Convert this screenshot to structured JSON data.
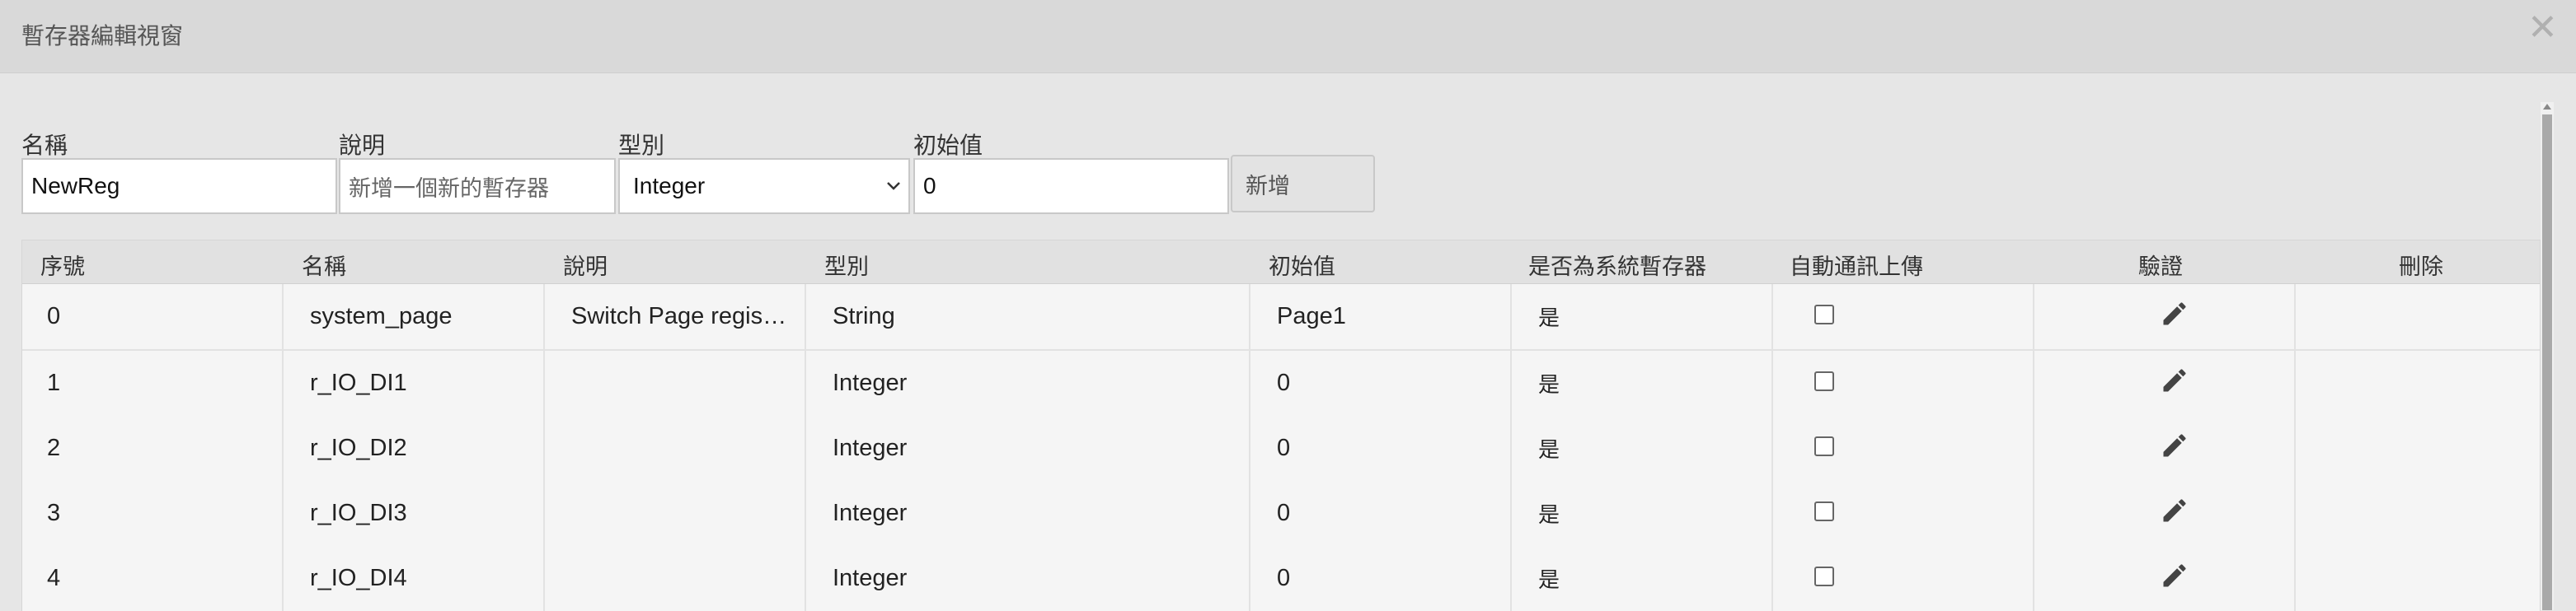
{
  "window": {
    "title": "暫存器編輯視窗",
    "close_icon": "close-icon"
  },
  "form": {
    "name_label": "名稱",
    "name_value": "NewReg",
    "desc_label": "說明",
    "desc_placeholder": "新增一個新的暫存器",
    "type_label": "型別",
    "type_value": "Integer",
    "init_label": "初始值",
    "init_value": "0",
    "add_button": "新增"
  },
  "table": {
    "columns": [
      "序號",
      "名稱",
      "說明",
      "型別",
      "初始值",
      "是否為系統暫存器",
      "自動通訊上傳",
      "驗證",
      "刪除"
    ],
    "rows": [
      {
        "index": "0",
        "name": "system_page",
        "desc": "Switch Page register",
        "type": "String",
        "init": "Page1",
        "system": "是",
        "auto_upload": false
      },
      {
        "index": "1",
        "name": "r_IO_DI1",
        "desc": "",
        "type": "Integer",
        "init": "0",
        "system": "是",
        "auto_upload": false
      },
      {
        "index": "2",
        "name": "r_IO_DI2",
        "desc": "",
        "type": "Integer",
        "init": "0",
        "system": "是",
        "auto_upload": false
      },
      {
        "index": "3",
        "name": "r_IO_DI3",
        "desc": "",
        "type": "Integer",
        "init": "0",
        "system": "是",
        "auto_upload": false
      },
      {
        "index": "4",
        "name": "r_IO_DI4",
        "desc": "",
        "type": "Integer",
        "init": "0",
        "system": "是",
        "auto_upload": false
      }
    ]
  },
  "icons": {
    "edit": "pencil-icon",
    "checkbox": "checkbox-icon",
    "dropdown": "chevron-down-icon"
  }
}
